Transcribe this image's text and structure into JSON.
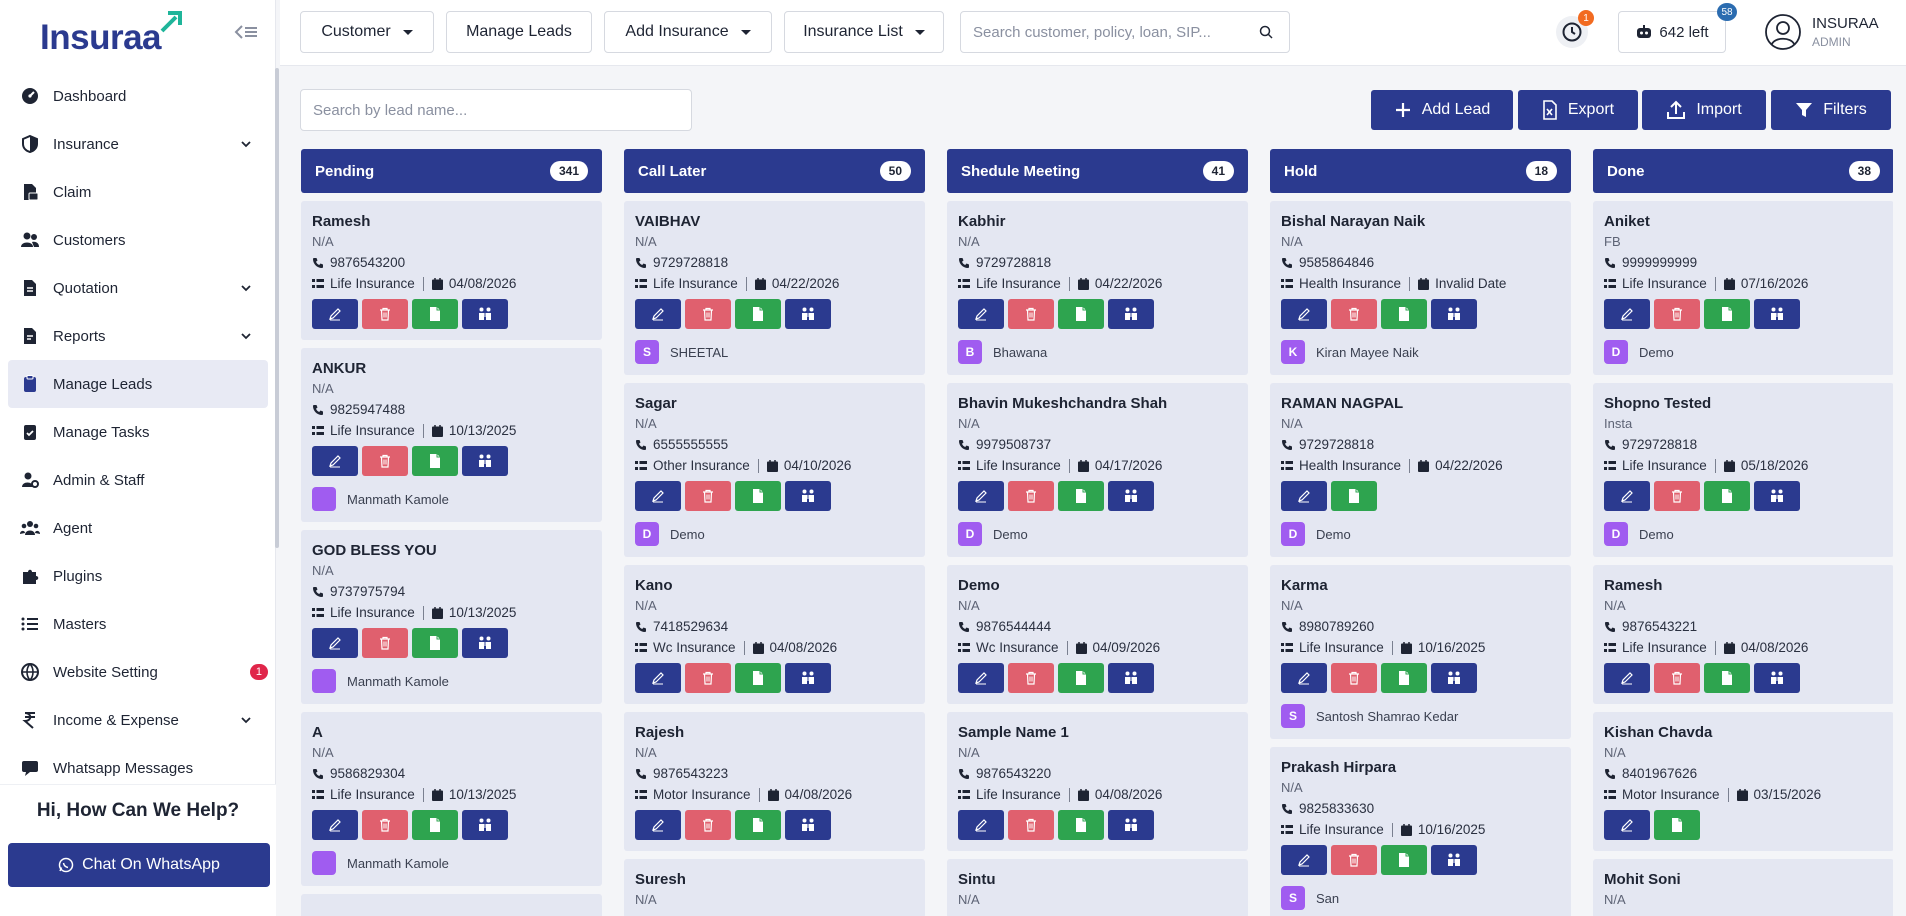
{
  "app": {
    "logo_text": "Insuraa",
    "brand_color": "#2b3a8f",
    "accent_green": "#1fb59a"
  },
  "sidebar": {
    "items": [
      {
        "label": "Dashboard",
        "icon": "gauge-icon",
        "chevron": false,
        "active": false
      },
      {
        "label": "Insurance",
        "icon": "shield-icon",
        "chevron": true,
        "active": false
      },
      {
        "label": "Claim",
        "icon": "claim-doc-icon",
        "chevron": false,
        "active": false
      },
      {
        "label": "Customers",
        "icon": "users-icon",
        "chevron": false,
        "active": false
      },
      {
        "label": "Quotation",
        "icon": "quotation-icon",
        "chevron": true,
        "active": false
      },
      {
        "label": "Reports",
        "icon": "file-icon",
        "chevron": true,
        "active": false
      },
      {
        "label": "Manage Leads",
        "icon": "clipboard-icon",
        "chevron": false,
        "active": true
      },
      {
        "label": "Manage Tasks",
        "icon": "clipboard-check-icon",
        "chevron": false,
        "active": false
      },
      {
        "label": "Admin & Staff",
        "icon": "user-gear-icon",
        "chevron": false,
        "active": false
      },
      {
        "label": "Agent",
        "icon": "group-icon",
        "chevron": false,
        "active": false
      },
      {
        "label": "Plugins",
        "icon": "puzzle-icon",
        "chevron": false,
        "active": false
      },
      {
        "label": "Masters",
        "icon": "list-icon",
        "chevron": false,
        "active": false
      },
      {
        "label": "Website Setting",
        "icon": "globe-icon",
        "chevron": false,
        "active": false,
        "badge": "1"
      },
      {
        "label": "Income & Expense",
        "icon": "rupee-icon",
        "chevron": true,
        "active": false
      },
      {
        "label": "Whatsapp Messages",
        "icon": "chat-icon",
        "chevron": false,
        "active": false
      }
    ],
    "help_title": "Hi, How Can We Help?",
    "chat_button": "Chat On WhatsApp"
  },
  "topbar": {
    "buttons": [
      {
        "label": "Customer",
        "dropdown": true
      },
      {
        "label": "Manage Leads",
        "dropdown": false
      },
      {
        "label": "Add Insurance",
        "dropdown": true
      },
      {
        "label": "Insurance List",
        "dropdown": true
      }
    ],
    "search_placeholder": "Search customer, policy, loan, SIP...",
    "clock_badge": "1",
    "credits_label": "642 left",
    "credits_badge": "58",
    "user_name": "INSURAA",
    "user_role": "ADMIN"
  },
  "leads": {
    "search_placeholder": "Search by lead name...",
    "actions": {
      "add": "Add Lead",
      "export": "Export",
      "import": "Import",
      "filters": "Filters"
    }
  },
  "board": {
    "columns": [
      {
        "title": "Pending",
        "count": "341",
        "cards": [
          {
            "name": "Ramesh",
            "source": "N/A",
            "phone": "9876543200",
            "type": "Life Insurance",
            "date": "04/08/2026",
            "buttons": [
              "edit",
              "delete",
              "note",
              "convert"
            ]
          },
          {
            "name": "ANKUR",
            "source": "N/A",
            "phone": "9825947488",
            "type": "Life Insurance",
            "date": "10/13/2025",
            "buttons": [
              "edit",
              "delete",
              "note",
              "convert"
            ],
            "assignee": "Manmath Kamole",
            "initial": ""
          },
          {
            "name": "GOD BLESS YOU",
            "source": "N/A",
            "phone": "9737975794",
            "type": "Life Insurance",
            "date": "10/13/2025",
            "buttons": [
              "edit",
              "delete",
              "note",
              "convert"
            ],
            "assignee": "Manmath Kamole",
            "initial": ""
          },
          {
            "name": "A",
            "source": "N/A",
            "phone": "9586829304",
            "type": "Life Insurance",
            "date": "10/13/2025",
            "buttons": [
              "edit",
              "delete",
              "note",
              "convert"
            ],
            "assignee": "Manmath Kamole",
            "initial": ""
          },
          {
            "name": "",
            "source": "",
            "phone": "",
            "type": "",
            "date": "",
            "buttons": []
          }
        ]
      },
      {
        "title": "Call Later",
        "count": "50",
        "cards": [
          {
            "name": "VAIBHAV",
            "source": "N/A",
            "phone": "9729728818",
            "type": "Life Insurance",
            "date": "04/22/2026",
            "buttons": [
              "edit",
              "delete",
              "note",
              "convert"
            ],
            "assignee": "SHEETAL",
            "initial": "S"
          },
          {
            "name": "Sagar",
            "source": "N/A",
            "phone": "6555555555",
            "type": "Other Insurance",
            "date": "04/10/2026",
            "buttons": [
              "edit",
              "delete",
              "note",
              "convert"
            ],
            "assignee": "Demo",
            "initial": "D"
          },
          {
            "name": "Kano",
            "source": "N/A",
            "phone": "7418529634",
            "type": "Wc Insurance",
            "date": "04/08/2026",
            "buttons": [
              "edit",
              "delete",
              "note",
              "convert"
            ]
          },
          {
            "name": "Rajesh",
            "source": "N/A",
            "phone": "9876543223",
            "type": "Motor Insurance",
            "date": "04/08/2026",
            "buttons": [
              "edit",
              "delete",
              "note",
              "convert"
            ]
          },
          {
            "name": "Suresh",
            "source": "N/A",
            "phone": "",
            "type": "",
            "date": "",
            "buttons": []
          }
        ]
      },
      {
        "title": "Shedule Meeting",
        "count": "41",
        "cards": [
          {
            "name": "Kabhir",
            "source": "N/A",
            "phone": "9729728818",
            "type": "Life Insurance",
            "date": "04/22/2026",
            "buttons": [
              "edit",
              "delete",
              "note",
              "convert"
            ],
            "assignee": "Bhawana",
            "initial": "B"
          },
          {
            "name": "Bhavin Mukeshchandra Shah",
            "source": "N/A",
            "phone": "9979508737",
            "type": "Life Insurance",
            "date": "04/17/2026",
            "buttons": [
              "edit",
              "delete",
              "note",
              "convert"
            ],
            "assignee": "Demo",
            "initial": "D"
          },
          {
            "name": "Demo",
            "source": "N/A",
            "phone": "9876544444",
            "type": "Wc Insurance",
            "date": "04/09/2026",
            "buttons": [
              "edit",
              "delete",
              "note",
              "convert"
            ]
          },
          {
            "name": "Sample Name 1",
            "source": "N/A",
            "phone": "9876543220",
            "type": "Life Insurance",
            "date": "04/08/2026",
            "buttons": [
              "edit",
              "delete",
              "note",
              "convert"
            ]
          },
          {
            "name": "Sintu",
            "source": "N/A",
            "phone": "",
            "type": "",
            "date": "",
            "buttons": []
          }
        ]
      },
      {
        "title": "Hold",
        "count": "18",
        "cards": [
          {
            "name": "Bishal Narayan Naik",
            "source": "N/A",
            "phone": "9585864846",
            "type": "Health Insurance",
            "date": "Invalid Date",
            "buttons": [
              "edit",
              "delete",
              "note",
              "convert"
            ],
            "assignee": "Kiran Mayee Naik",
            "initial": "K"
          },
          {
            "name": "RAMAN NAGPAL",
            "source": "N/A",
            "phone": "9729728818",
            "type": "Health Insurance",
            "date": "04/22/2026",
            "buttons": [
              "edit",
              "note"
            ],
            "assignee": "Demo",
            "initial": "D"
          },
          {
            "name": "Karma",
            "source": "N/A",
            "phone": "8980789260",
            "type": "Life Insurance",
            "date": "10/16/2025",
            "buttons": [
              "edit",
              "delete",
              "note",
              "convert"
            ],
            "assignee": "Santosh Shamrao Kedar",
            "initial": "S"
          },
          {
            "name": "Prakash Hirpara",
            "source": "N/A",
            "phone": "9825833630",
            "type": "Life Insurance",
            "date": "10/16/2025",
            "buttons": [
              "edit",
              "delete",
              "note",
              "convert"
            ],
            "assignee": "San",
            "initial": "S"
          }
        ]
      },
      {
        "title": "Done",
        "count": "38",
        "cards": [
          {
            "name": "Aniket",
            "source": "FB",
            "phone": "9999999999",
            "type": "Life Insurance",
            "date": "07/16/2026",
            "buttons": [
              "edit",
              "delete",
              "note",
              "convert"
            ],
            "assignee": "Demo",
            "initial": "D"
          },
          {
            "name": "Shopno Tested",
            "source": "Insta",
            "phone": "9729728818",
            "type": "Life Insurance",
            "date": "05/18/2026",
            "buttons": [
              "edit",
              "delete",
              "note",
              "convert"
            ],
            "assignee": "Demo",
            "initial": "D"
          },
          {
            "name": "Ramesh",
            "source": "N/A",
            "phone": "9876543221",
            "type": "Life Insurance",
            "date": "04/08/2026",
            "buttons": [
              "edit",
              "delete",
              "note",
              "convert"
            ]
          },
          {
            "name": "Kishan Chavda",
            "source": "N/A",
            "phone": "8401967626",
            "type": "Motor Insurance",
            "date": "03/15/2026",
            "buttons": [
              "edit",
              "note"
            ]
          },
          {
            "name": "Mohit Soni",
            "source": "N/A",
            "phone": "",
            "type": "",
            "date": "",
            "buttons": []
          }
        ]
      }
    ]
  }
}
